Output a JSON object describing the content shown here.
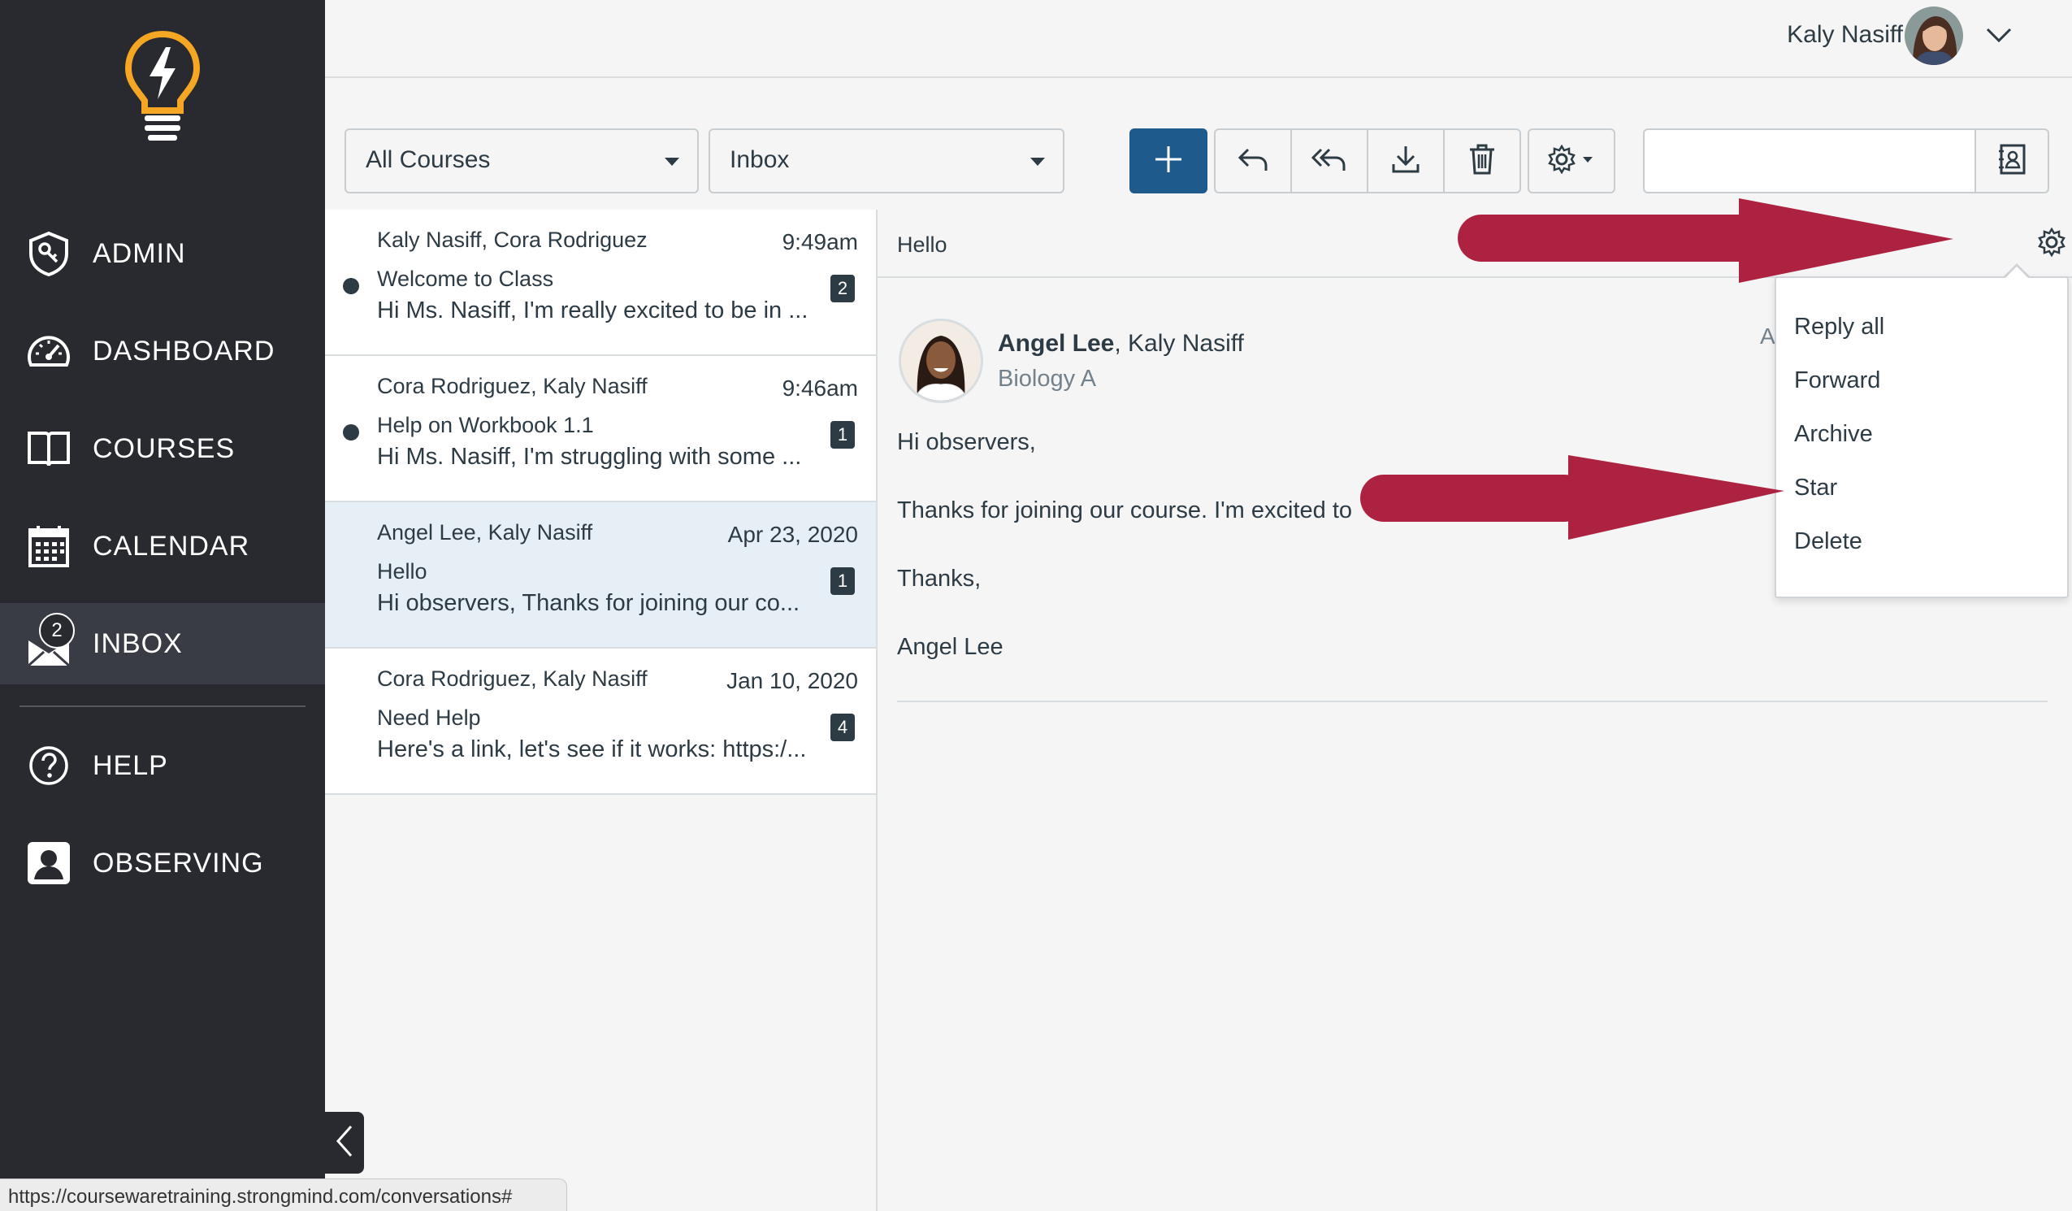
{
  "sidebar": {
    "items": [
      {
        "label": "ADMIN",
        "icon": "admin-shield-icon"
      },
      {
        "label": "DASHBOARD",
        "icon": "speedometer-icon"
      },
      {
        "label": "COURSES",
        "icon": "book-icon"
      },
      {
        "label": "CALENDAR",
        "icon": "calendar-icon"
      },
      {
        "label": "INBOX",
        "icon": "envelope-icon",
        "badge": "2"
      },
      {
        "label": "HELP",
        "icon": "help-circle-icon"
      },
      {
        "label": "OBSERVING",
        "icon": "observer-icon"
      }
    ],
    "logo_icon": "lightbulb-logo-icon",
    "collapse_icon": "chevron-left-icon"
  },
  "header": {
    "user_name": "Kaly Nasiff",
    "avatar_icon": "user-avatar",
    "caret_icon": "chevron-down-icon"
  },
  "toolbar": {
    "course_filter": "All Courses",
    "mailbox_filter": "Inbox",
    "buttons": [
      "compose-icon",
      "reply-icon",
      "reply-all-icon",
      "archive-icon",
      "delete-icon",
      "settings-icon"
    ],
    "search_placeholder": "",
    "contacts_icon": "address-book-icon"
  },
  "conversations": [
    {
      "participants": "Kaly Nasiff, Cora Rodriguez",
      "date": "9:49am",
      "subject": "Welcome to Class",
      "snippet": "Hi Ms. Nasiff, I'm really excited to be in ...",
      "count": "2",
      "unread": true
    },
    {
      "participants": "Cora Rodriguez, Kaly Nasiff",
      "date": "9:46am",
      "subject": "Help on Workbook 1.1",
      "snippet": "Hi Ms. Nasiff, I'm struggling with some ...",
      "count": "1",
      "unread": true
    },
    {
      "participants": "Angel Lee, Kaly Nasiff",
      "date": "Apr 23, 2020",
      "subject": "Hello",
      "snippet": "Hi observers, Thanks for joining our co...",
      "count": "1",
      "unread": false,
      "selected": true
    },
    {
      "participants": "Cora Rodriguez, Kaly Nasiff",
      "date": "Jan 10, 2020",
      "subject": "Need Help",
      "snippet": "Here's a link, let's see if it works: https:/...",
      "count": "4",
      "unread": false
    }
  ],
  "message": {
    "subject": "Hello",
    "author": "Angel Lee",
    "recipients": ", Kaly Nasiff",
    "course": "Biology A",
    "date_clipped": "A",
    "body": [
      "Hi observers,",
      "Thanks for joining our course. I'm excited to",
      "Thanks,",
      "Angel Lee"
    ]
  },
  "menu": {
    "items": [
      "Reply all",
      "Forward",
      "Archive",
      "Star",
      "Delete"
    ]
  },
  "status_bar": {
    "url": "https://coursewaretraining.strongmind.com/conversations#"
  },
  "colors": {
    "sidebar_bg": "#282a30",
    "accent_blue": "#1f5a8c",
    "annotation_arrow": "#ad2240",
    "logo_yellow": "#f5a623"
  }
}
